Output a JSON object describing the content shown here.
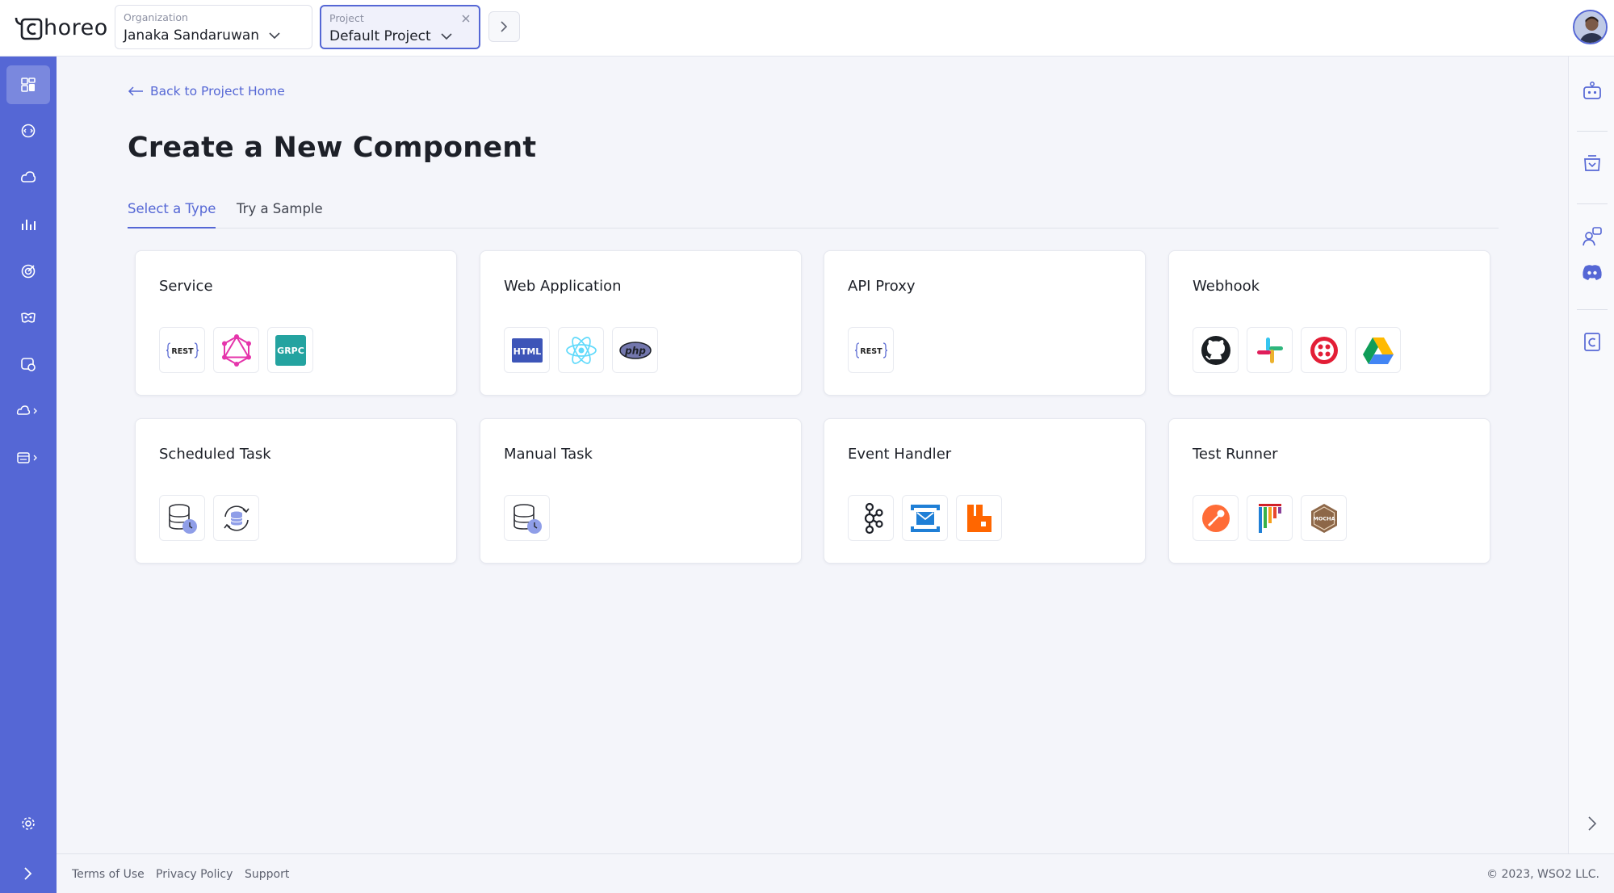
{
  "brand": {
    "name": "horeo",
    "accent": "#5567d5"
  },
  "header": {
    "organization": {
      "label": "Organization",
      "value": "Janaka Sandaruwan"
    },
    "project": {
      "label": "Project",
      "value": "Default Project"
    }
  },
  "left_nav": {
    "items": [
      {
        "icon": "overview-icon",
        "active": true
      },
      {
        "icon": "develop-icon"
      },
      {
        "icon": "deploy-icon"
      },
      {
        "icon": "observe-icon"
      },
      {
        "icon": "test-icon"
      },
      {
        "icon": "manage-icon"
      },
      {
        "icon": "settings-component-icon"
      },
      {
        "icon": "dependencies-icon"
      },
      {
        "icon": "devops-icon"
      },
      {
        "icon": "settings-icon"
      }
    ]
  },
  "right_nav": {
    "items": [
      {
        "icon": "api-chat-icon"
      },
      {
        "icon": "marketplace-icon"
      },
      {
        "icon": "support-chat-icon"
      },
      {
        "icon": "discord-icon"
      },
      {
        "icon": "docs-icon"
      }
    ]
  },
  "main": {
    "back_link": "Back to Project Home",
    "title": "Create a New Component",
    "tabs": [
      {
        "label": "Select a Type",
        "active": true
      },
      {
        "label": "Try a Sample",
        "active": false
      }
    ],
    "cards": [
      {
        "title": "Service",
        "icons": [
          "rest-icon",
          "graphql-icon",
          "grpc-icon"
        ]
      },
      {
        "title": "Web Application",
        "icons": [
          "html-icon",
          "react-icon",
          "php-icon"
        ]
      },
      {
        "title": "API Proxy",
        "icons": [
          "rest-icon"
        ]
      },
      {
        "title": "Webhook",
        "icons": [
          "github-icon",
          "slack-icon",
          "twilio-icon",
          "google-drive-icon"
        ]
      },
      {
        "title": "Scheduled Task",
        "icons": [
          "database-clock-icon",
          "database-sync-icon"
        ]
      },
      {
        "title": "Manual Task",
        "icons": [
          "database-clock-icon"
        ]
      },
      {
        "title": "Event Handler",
        "icons": [
          "kafka-icon",
          "azure-service-bus-icon",
          "rabbitmq-icon"
        ]
      },
      {
        "title": "Test Runner",
        "icons": [
          "postman-icon",
          "jmeter-icon",
          "mocha-icon"
        ]
      }
    ],
    "icon_text": {
      "rest": "REST",
      "grpc": "GRPC",
      "html": "HTML",
      "php": "php",
      "mocha": "MOCHA"
    }
  },
  "footer": {
    "links": [
      "Terms of Use",
      "Privacy Policy",
      "Support"
    ],
    "copyright": "© 2023, WSO2 LLC."
  }
}
